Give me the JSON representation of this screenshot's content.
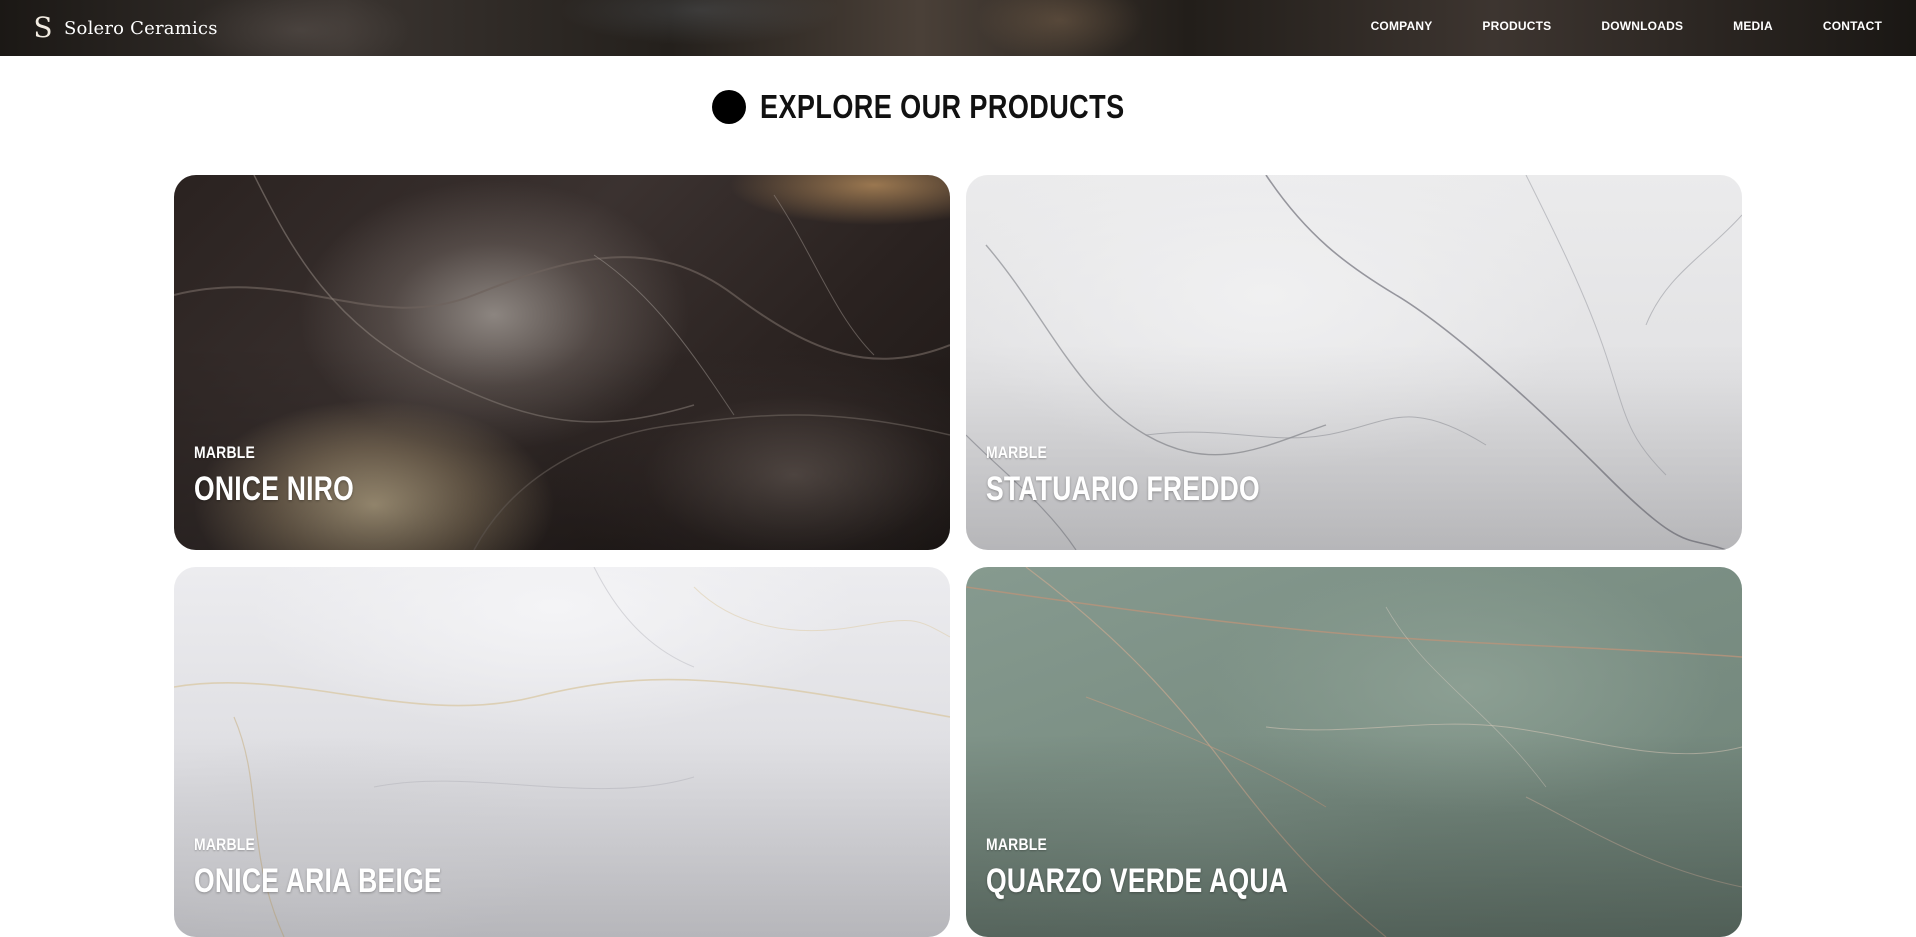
{
  "header": {
    "brand_mark": "S",
    "brand_name": "Solero Ceramics",
    "nav": [
      "COMPANY",
      "PRODUCTS",
      "DOWNLOADS",
      "MEDIA",
      "CONTACT"
    ]
  },
  "section": {
    "title": "EXPLORE OUR PRODUCTS"
  },
  "products": [
    {
      "category": "MARBLE",
      "name": "ONICE NIRO"
    },
    {
      "category": "MARBLE",
      "name": "STATUARIO FREDDO"
    },
    {
      "category": "MARBLE",
      "name": "ONICE ARIA BEIGE"
    },
    {
      "category": "MARBLE",
      "name": "QUARZO VERDE AQUA"
    }
  ],
  "colors": {
    "header_bg": "#24201c",
    "title_text": "#111111",
    "title_dot": "#000000",
    "card_text": "#ffffff"
  }
}
